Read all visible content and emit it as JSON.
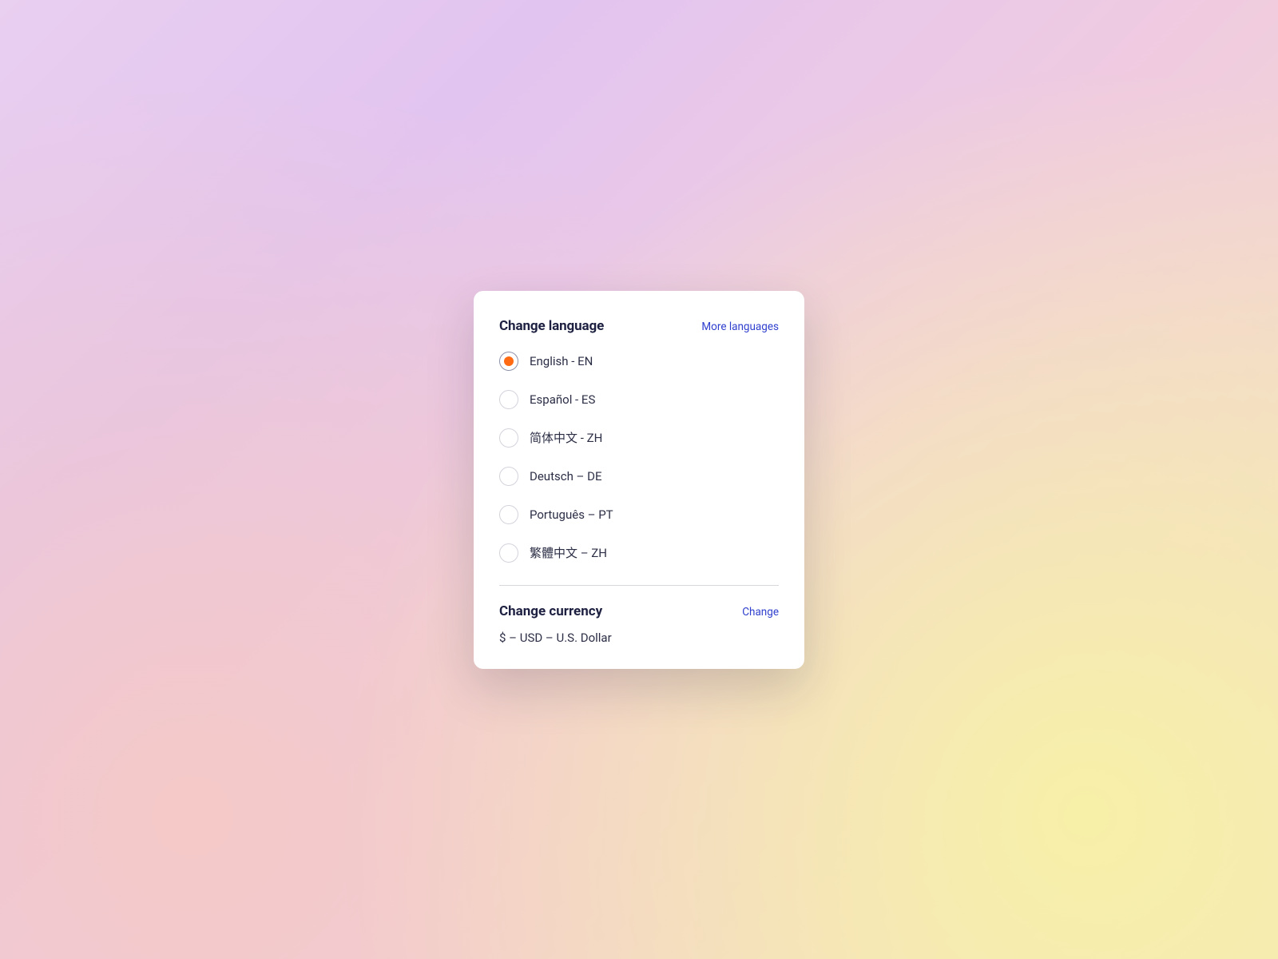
{
  "language": {
    "title": "Change language",
    "more_label": "More languages",
    "selected_index": 0,
    "options": [
      {
        "label": "English - EN"
      },
      {
        "label": "Español - ES"
      },
      {
        "label": "简体中文 - ZH"
      },
      {
        "label": "Deutsch – DE"
      },
      {
        "label": "Português – PT"
      },
      {
        "label": "繁體中文 – ZH"
      }
    ]
  },
  "currency": {
    "title": "Change currency",
    "change_label": "Change",
    "value": "$ – USD – U.S. Dollar"
  },
  "colors": {
    "accent_orange": "#ff6a13",
    "link_blue": "#2f3fcd",
    "text_dark": "#1d2040"
  }
}
